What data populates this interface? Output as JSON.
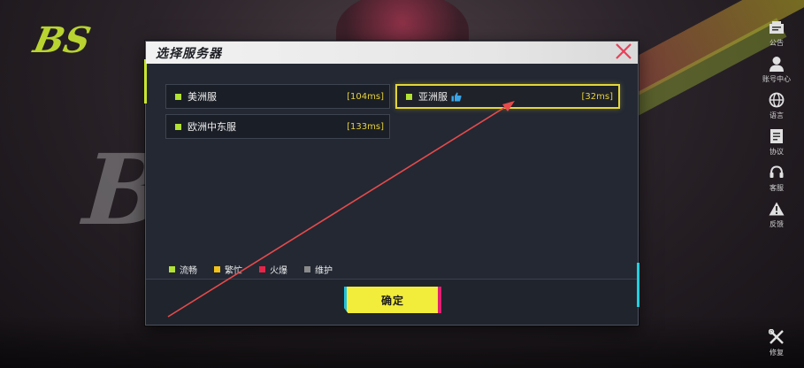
{
  "dialog": {
    "title": "选择服务器",
    "confirm_label": "确定"
  },
  "servers": [
    {
      "name": "美洲服",
      "ping": "[104ms]",
      "status_color": "#b2e234",
      "selected": false,
      "recommended": false
    },
    {
      "name": "亚洲服",
      "ping": "[32ms]",
      "status_color": "#b2e234",
      "selected": true,
      "recommended": true
    },
    {
      "name": "欧洲中东服",
      "ping": "[133ms]",
      "status_color": "#b2e234",
      "selected": false,
      "recommended": false
    }
  ],
  "legend": [
    {
      "label": "流畅",
      "color": "#b2e234"
    },
    {
      "label": "繁忙",
      "color": "#f2c21a"
    },
    {
      "label": "火爆",
      "color": "#e8244a"
    },
    {
      "label": "维护",
      "color": "#8a8a8a"
    }
  ],
  "side_menu": [
    {
      "label": "公告",
      "icon": "announcement-icon"
    },
    {
      "label": "账号中心",
      "icon": "account-icon"
    },
    {
      "label": "语言",
      "icon": "globe-icon"
    },
    {
      "label": "协议",
      "icon": "document-icon"
    },
    {
      "label": "客服",
      "icon": "headset-icon"
    },
    {
      "label": "反馈",
      "icon": "warning-icon"
    }
  ],
  "repair": {
    "label": "修复",
    "icon": "tools-icon"
  },
  "logo": {
    "text": "BS"
  },
  "colors": {
    "accent_yellow": "#f2ed3a",
    "selected_border": "#e4d63a",
    "ping_text": "#e6d13a",
    "annotation_arrow": "#e84a4a"
  }
}
